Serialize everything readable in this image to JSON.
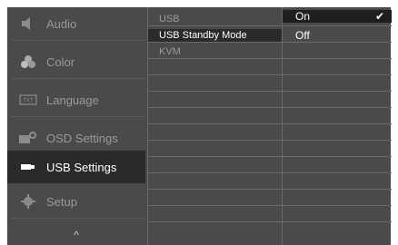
{
  "menu": {
    "items": [
      {
        "label": "Audio",
        "icon": "speaker-icon"
      },
      {
        "label": "Color",
        "icon": "color-palette-icon"
      },
      {
        "label": "Language",
        "icon": "language-icon"
      },
      {
        "label": "OSD Settings",
        "icon": "osd-settings-icon"
      },
      {
        "label": "USB Settings",
        "icon": "usb-icon"
      },
      {
        "label": "Setup",
        "icon": "gear-icon"
      }
    ],
    "selected": "USB Settings",
    "scroll_up": "^"
  },
  "submenu": {
    "items": [
      "USB",
      "USB Standby Mode",
      "KVM"
    ],
    "highlighted": "USB Standby Mode"
  },
  "options": {
    "items": [
      "On",
      "Off"
    ],
    "selected": "On",
    "check": "✔"
  },
  "colors": {
    "panel": "#4a4a4a",
    "selected_bg": "#2a2a2a",
    "text_active": "#ffffff",
    "text_inactive": "#9a9a9a"
  }
}
